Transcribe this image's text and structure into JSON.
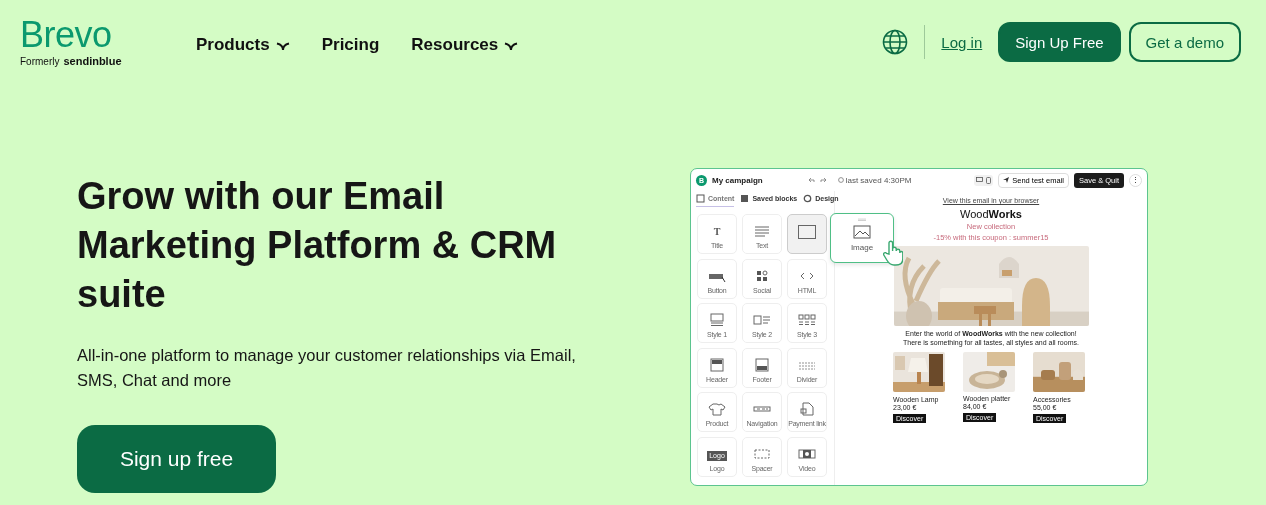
{
  "header": {
    "logo": "Brevo",
    "logo_note": "Formerly",
    "logo_former": "sendinblue",
    "nav": [
      {
        "label": "Products",
        "dropdown": true
      },
      {
        "label": "Pricing",
        "dropdown": false
      },
      {
        "label": "Resources",
        "dropdown": true
      }
    ],
    "login": "Log in",
    "signup": "Sign Up Free",
    "demo": "Get a demo"
  },
  "hero": {
    "title": "Grow with our Email Marketing Platform & CRM suite",
    "subtitle": "All-in-one platform to manage your customer relationships via Email, SMS, Chat and more",
    "cta": "Sign up free"
  },
  "editor": {
    "logo": "B",
    "campaign": "My campaign",
    "last_saved": "last saved 4:30PM",
    "send_test": "Send test email",
    "save_quit": "Save & Quit",
    "more": "⋮",
    "tabs": [
      {
        "label": "Content",
        "selected": true
      },
      {
        "label": "Saved blocks",
        "selected": false
      },
      {
        "label": "Design",
        "selected": false
      }
    ],
    "blocks": [
      {
        "label": "Title",
        "icon_text": "T",
        "selected": false
      },
      {
        "label": "Text",
        "selected": false
      },
      {
        "selected": true
      },
      {
        "label": "Button",
        "selected": false
      },
      {
        "label": "Social",
        "selected": false
      },
      {
        "label": "HTML",
        "selected": false
      },
      {
        "label": "Style 1",
        "selected": false
      },
      {
        "label": "Style 2",
        "selected": false
      },
      {
        "label": "Style 3",
        "selected": false
      },
      {
        "label": "Header",
        "selected": false
      },
      {
        "label": "Footer",
        "selected": false
      },
      {
        "label": "Divider",
        "selected": false
      },
      {
        "label": "Product",
        "selected": false
      },
      {
        "label": "Navigation",
        "selected": false
      },
      {
        "label": "Payment link",
        "selected": false
      },
      {
        "label": "Logo",
        "icon_text": "Logo",
        "selected": false
      },
      {
        "label": "Spacer",
        "selected": false
      },
      {
        "label": "Video",
        "selected": false
      }
    ],
    "dragged_block": "Image",
    "email": {
      "browser_link": "View this email in your browser",
      "brand": "Wood**Works**",
      "tagline": "New collection",
      "coupon": "-15% with this coupon : summer15",
      "intro": [
        "Enter the world of **WoodWorks** with the new collection!",
        "There is something for all tastes, all styles and all rooms."
      ],
      "products": [
        {
          "name": "Wooden Lamp",
          "price": "23,00 €",
          "button": "Discover"
        },
        {
          "name": "Wooden platter",
          "price": "84,00 €",
          "button": "Discover"
        },
        {
          "name": "Accessories",
          "price": "55,00 €",
          "button": "Discover"
        }
      ]
    }
  }
}
